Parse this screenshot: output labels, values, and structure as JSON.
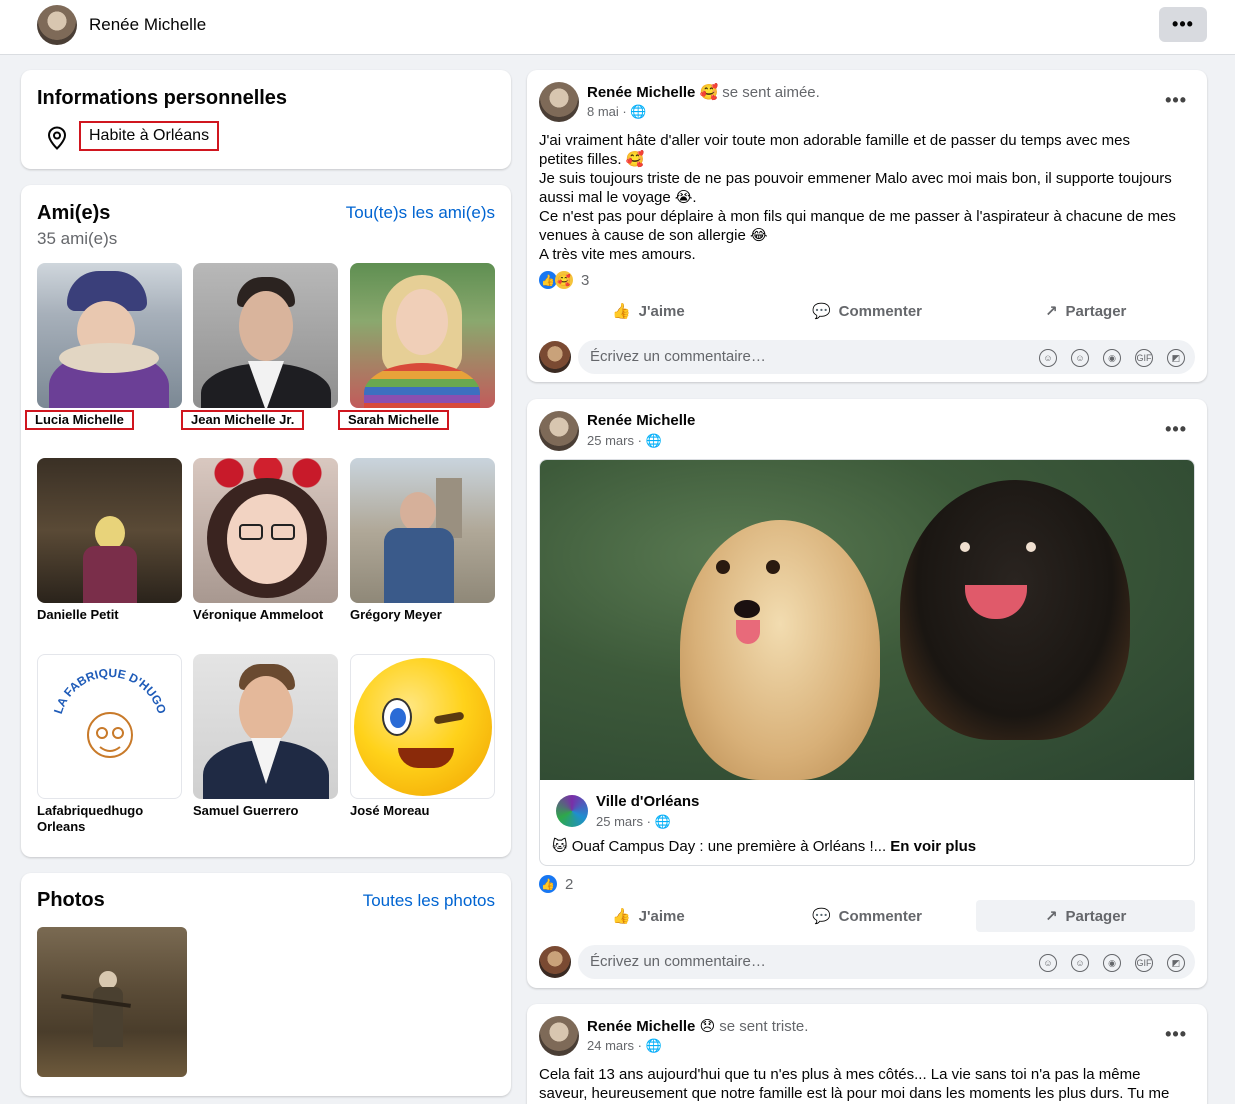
{
  "header": {
    "name": "Renée Michelle",
    "more": "•••"
  },
  "info": {
    "title": "Informations personnelles",
    "location": "Habite à Orléans"
  },
  "friends": {
    "title": "Ami(e)s",
    "count": "35 ami(e)s",
    "see_all": "Tou(te)s les ami(e)s",
    "items": [
      {
        "name": "Lucia Michelle"
      },
      {
        "name": "Jean Michelle Jr."
      },
      {
        "name": "Sarah Michelle"
      },
      {
        "name": "Danielle Petit"
      },
      {
        "name": "Véronique Ammeloot"
      },
      {
        "name": "Grégory Meyer"
      },
      {
        "name": "Lafabriquedhugo Orleans"
      },
      {
        "name": "Samuel Guerrero"
      },
      {
        "name": "José Moreau"
      }
    ],
    "logo_text": "LA FABRIQUE D'HUGO"
  },
  "photos": {
    "title": "Photos",
    "see_all": "Toutes les photos"
  },
  "posts": [
    {
      "author": "Renée Michelle",
      "feeling": "se sent aimée.",
      "date": "8 mai ·",
      "lines": [
        "J'ai vraiment hâte d'aller voir toute mon adorable famille et de passer du temps avec mes",
        "petites filles. 🥰",
        "Je suis toujours triste de ne pas pouvoir emmener Malo avec moi mais bon, il supporte toujours",
        "aussi mal le voyage 😭.",
        "Ce n'est pas pour déplaire à mon fils qui manque de me passer à l'aspirateur à chacune de mes",
        "venues à cause de son allergie 😂",
        "A très vite mes amours."
      ],
      "reactions": "3"
    },
    {
      "author": "Renée Michelle",
      "date": "25 mars ·",
      "shared": {
        "page": "Ville d'Orléans",
        "date": "25 mars ·",
        "text": "🐱 Ouaf Campus Day : une première à Orléans !...",
        "more": "En voir plus"
      },
      "reactions": "2"
    },
    {
      "author": "Renée Michelle",
      "feeling": "se sent triste.",
      "date": "24 mars ·",
      "lines": [
        "Cela fait 13 ans aujourd'hui que tu n'es plus à mes côtés... La vie sans toi n'a pas la même",
        "saveur, heureusement que notre famille est là pour moi dans les moments les plus durs. Tu me"
      ]
    }
  ],
  "actions": {
    "like": "J'aime",
    "comment": "Commenter",
    "share": "Partager"
  },
  "composer": {
    "placeholder": "Écrivez un commentaire…"
  },
  "colors": {
    "accent": "#0064d1",
    "highlight": "#d0161f",
    "like": "#1877f2"
  }
}
